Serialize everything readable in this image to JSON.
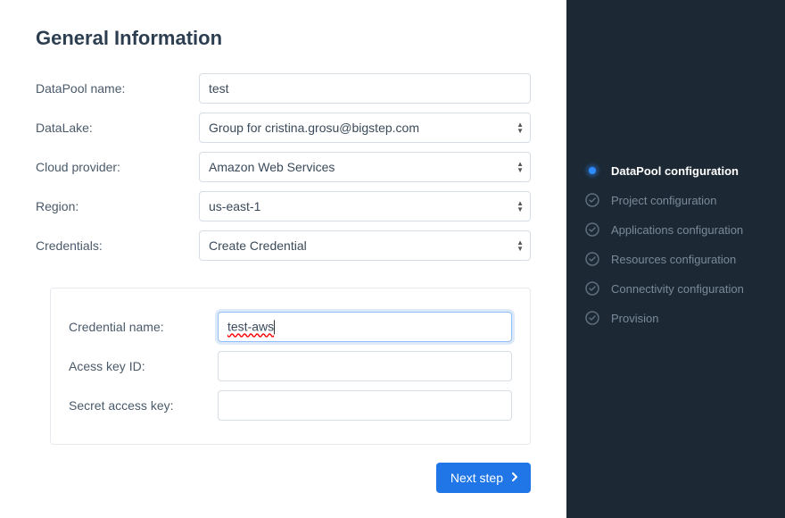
{
  "main": {
    "title": "General Information",
    "labels": {
      "datapool": "DataPool name:",
      "datalake": "DataLake:",
      "cloud": "Cloud provider:",
      "region": "Region:",
      "credentials": "Credentials:"
    },
    "values": {
      "datapool": "test",
      "datalake": "Group for cristina.grosu@bigstep.com",
      "cloud": "Amazon Web Services",
      "region": "us-east-1",
      "credentials": "Create Credential"
    },
    "cred_panel": {
      "labels": {
        "name": "Credential name:",
        "akid": "Acess key ID:",
        "secret": "Secret access key:"
      },
      "values": {
        "name": "test-aws",
        "akid": "",
        "secret": ""
      }
    },
    "next_button": "Next step"
  },
  "sidebar": {
    "steps": [
      {
        "label": "DataPool configuration",
        "active": true
      },
      {
        "label": "Project configuration",
        "active": false
      },
      {
        "label": "Applications configuration",
        "active": false
      },
      {
        "label": "Resources configuration",
        "active": false
      },
      {
        "label": "Connectivity configuration",
        "active": false
      },
      {
        "label": "Provision",
        "active": false
      }
    ]
  }
}
